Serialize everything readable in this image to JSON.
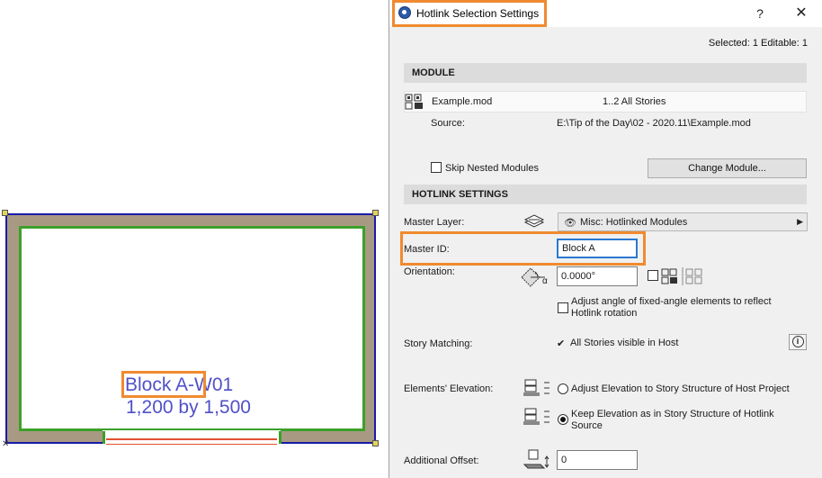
{
  "canvas": {
    "label_line1_highlight": "Block A",
    "label_line1_rest": "-W01",
    "label_line2": "1,200 by 1,500"
  },
  "dialog": {
    "title": "Hotlink Selection Settings",
    "help_glyph": "?",
    "close_glyph": "✕",
    "selection_info": "Selected: 1 Editable: 1",
    "module": {
      "section_label": "MODULE",
      "file_name": "Example.mod",
      "stories": "1..2 All Stories",
      "source_label": "Source:",
      "source_path": "E:\\Tip of the Day\\02 - 2020.11\\Example.mod",
      "skip_nested_label": "Skip Nested Modules",
      "skip_nested_checked": false,
      "change_module_button": "Change Module..."
    },
    "hotlink": {
      "section_label": "HOTLINK SETTINGS",
      "master_layer_label": "Master Layer:",
      "master_layer_value": "Misc: Hotlinked Modules",
      "master_id_label": "Master ID:",
      "master_id_value": "Block A",
      "orientation_label": "Orientation:",
      "orientation_value": "0.0000°",
      "orientation_alpha": "α",
      "adjust_angle_label_1": "Adjust angle of fixed-angle elements to reflect",
      "adjust_angle_label_2": "Hotlink rotation",
      "story_matching_label": "Story Matching:",
      "story_matching_check": "✔",
      "story_matching_value": "All Stories visible in Host",
      "info_glyph": "i",
      "elevation_label": "Elements' Elevation:",
      "elevation_option_1": "Adjust Elevation to Story Structure of Host Project",
      "elevation_option_2_line1": "Keep Elevation as in Story Structure of Hotlink",
      "elevation_option_2_line2": "Source",
      "elevation_selected": 2,
      "additional_offset_label": "Additional Offset:",
      "additional_offset_value": "0"
    }
  },
  "colors": {
    "highlight": "#f08a30",
    "wall_fill": "#a89a82",
    "wall_outline": "#1a1aa8",
    "inner_outline": "#3ca02a",
    "label_text": "#5050c8"
  }
}
